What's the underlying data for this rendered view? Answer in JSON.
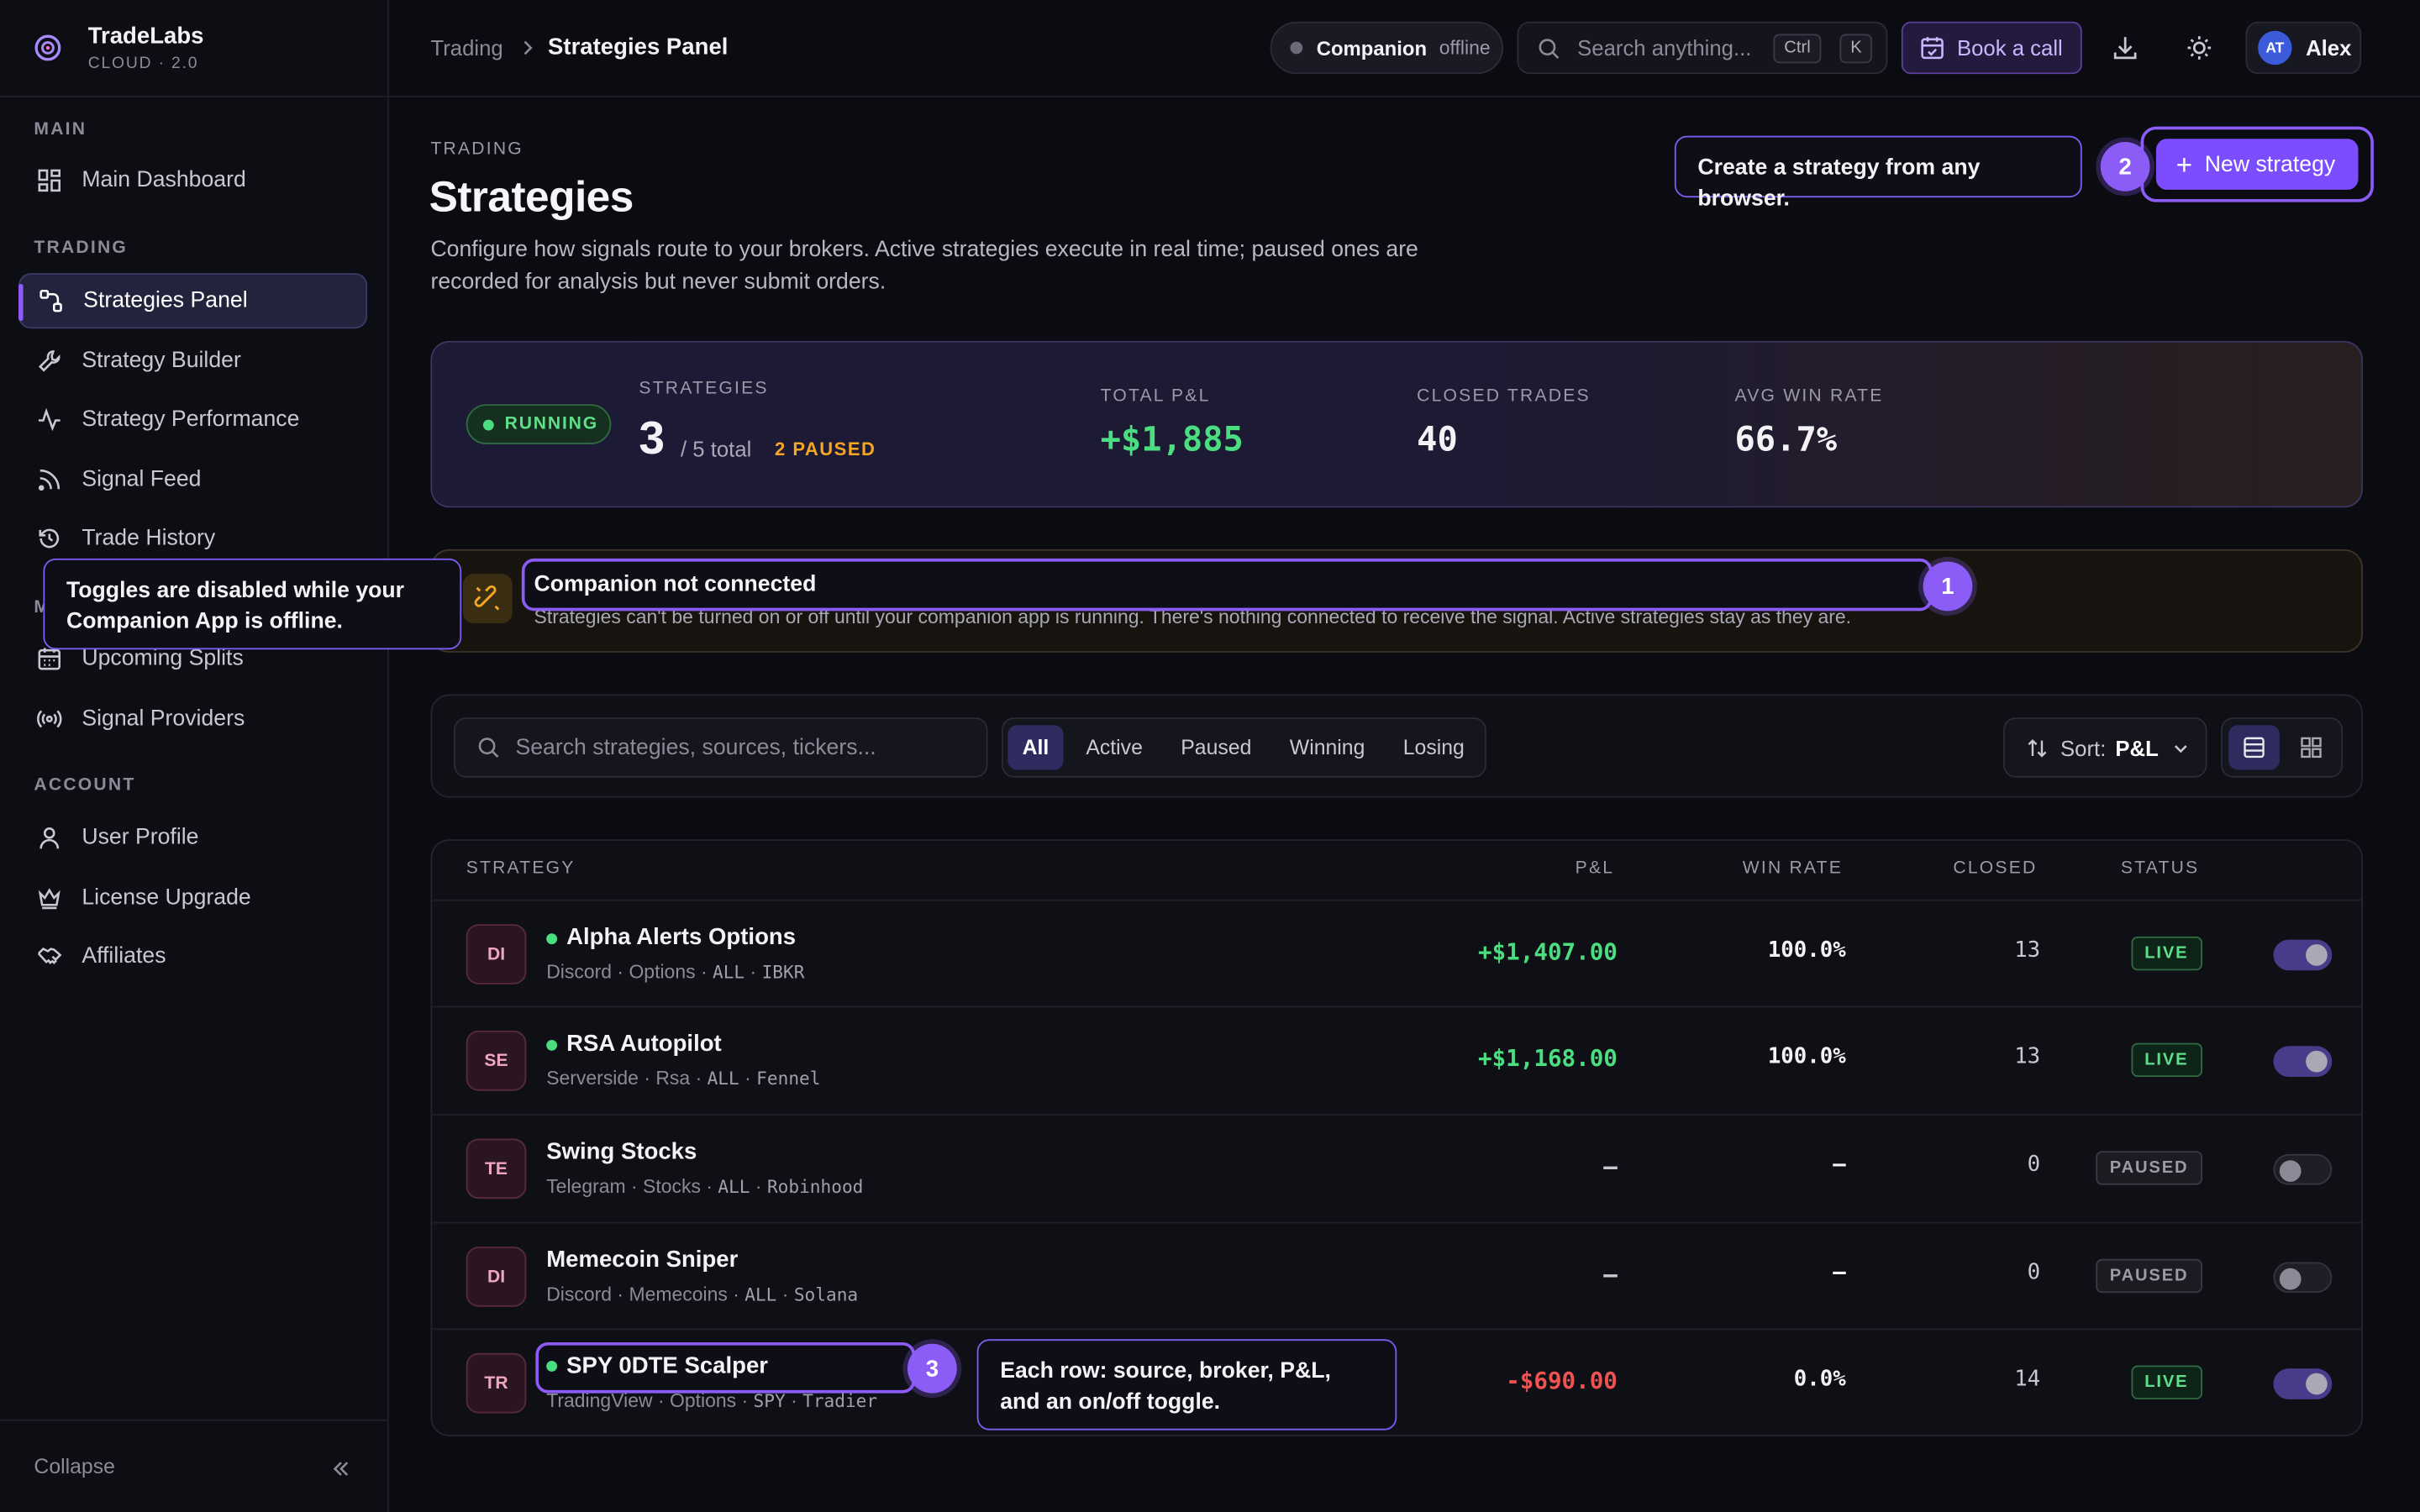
{
  "app": {
    "name": "TradeLabs",
    "edition": "CLOUD · 2.0"
  },
  "sidebar": {
    "sections": {
      "main": "MAIN",
      "trading": "TRADING",
      "account": "ACCOUNT"
    },
    "items": [
      {
        "label": "Main Dashboard",
        "icon": "dashboard-icon"
      },
      {
        "label": "Strategies Panel",
        "icon": "strategies-icon",
        "active": true
      },
      {
        "label": "Strategy Builder",
        "icon": "wrench-icon"
      },
      {
        "label": "Strategy Performance",
        "icon": "activity-icon"
      },
      {
        "label": "Signal Feed",
        "icon": "rss-icon"
      },
      {
        "label": "Trade History",
        "icon": "history-icon"
      },
      {
        "label": "Upcoming Splits",
        "icon": "calendar-icon"
      },
      {
        "label": "Signal Providers",
        "icon": "broadcast-icon"
      },
      {
        "label": "User Profile",
        "icon": "user-icon"
      },
      {
        "label": "License Upgrade",
        "icon": "crown-icon"
      },
      {
        "label": "Affiliates",
        "icon": "handshake-icon"
      }
    ],
    "collapse_label": "Collapse"
  },
  "topbar": {
    "breadcrumb": [
      "Trading",
      "Strategies Panel"
    ],
    "companion": {
      "label": "Companion",
      "status": "offline"
    },
    "search": {
      "placeholder": "Search anything...",
      "kbd1": "Ctrl",
      "kbd2": "K"
    },
    "book_call": "Book a call",
    "user": {
      "initials": "AT",
      "name": "Alex"
    }
  },
  "header": {
    "eyebrow": "TRADING",
    "title": "Strategies",
    "description": "Configure how signals route to your brokers. Active strategies execute in real time; paused ones are recorded for analysis but never submit orders.",
    "new_strategy": "New strategy"
  },
  "tour": {
    "tip_create": "Create a strategy from any browser.",
    "tip_toggles": "Toggles are disabled while your Companion App is offline.",
    "tip_rows": "Each row: source, broker, P&L, and an on/off toggle.",
    "step1": "1",
    "step2": "2",
    "step3": "3"
  },
  "stats": {
    "status": "RUNNING",
    "strategies_label": "STRATEGIES",
    "strategies_active": "3",
    "strategies_total": "/ 5 total",
    "paused": "2 PAUSED",
    "pnl_label": "TOTAL P&L",
    "pnl_value": "+$1,885",
    "closed_label": "CLOSED TRADES",
    "closed_value": "40",
    "winrate_label": "AVG WIN RATE",
    "winrate_value": "66.7%"
  },
  "alert": {
    "title": "Companion not connected",
    "message": "Strategies can't be turned on or off until your companion app is running. There's nothing connected to receive the signal. Active strategies stay as they are."
  },
  "filters": {
    "search_placeholder": "Search strategies, sources, tickers...",
    "chips": [
      "All",
      "Active",
      "Paused",
      "Winning",
      "Losing"
    ],
    "active_chip": "All",
    "sort_label": "Sort:",
    "sort_value": "P&L"
  },
  "table": {
    "headers": {
      "strategy": "STRATEGY",
      "pnl": "P&L",
      "winrate": "WIN RATE",
      "closed": "CLOSED",
      "status": "STATUS"
    },
    "rows": [
      {
        "abbr": "DI",
        "name": "Alpha Alerts Options",
        "source": "Discord",
        "type": "Options",
        "scope": "ALL",
        "broker": "IBKR",
        "pnl": "+$1,407.00",
        "winrate": "100.0%",
        "closed": "13",
        "status": "LIVE",
        "on": true
      },
      {
        "abbr": "SE",
        "name": "RSA Autopilot",
        "source": "Serverside",
        "type": "Rsa",
        "scope": "ALL",
        "broker": "Fennel",
        "pnl": "+$1,168.00",
        "winrate": "100.0%",
        "closed": "13",
        "status": "LIVE",
        "on": true
      },
      {
        "abbr": "TE",
        "name": "Swing Stocks",
        "source": "Telegram",
        "type": "Stocks",
        "scope": "ALL",
        "broker": "Robinhood",
        "pnl": "—",
        "winrate": "—",
        "closed": "0",
        "status": "PAUSED",
        "on": false
      },
      {
        "abbr": "DI",
        "name": "Memecoin Sniper",
        "source": "Discord",
        "type": "Memecoins",
        "scope": "ALL",
        "broker": "Solana",
        "pnl": "—",
        "winrate": "—",
        "closed": "0",
        "status": "PAUSED",
        "on": false
      },
      {
        "abbr": "TR",
        "name": "SPY 0DTE Scalper",
        "source": "TradingView",
        "type": "Options",
        "scope": "SPY",
        "broker": "Tradier",
        "pnl": "-$690.00",
        "winrate": "0.0%",
        "closed": "14",
        "status": "LIVE",
        "on": true
      }
    ]
  },
  "colors": {
    "accent": "#8b5cf6",
    "positive": "#4ade80",
    "negative": "#f05252",
    "warning": "#f5a623"
  }
}
